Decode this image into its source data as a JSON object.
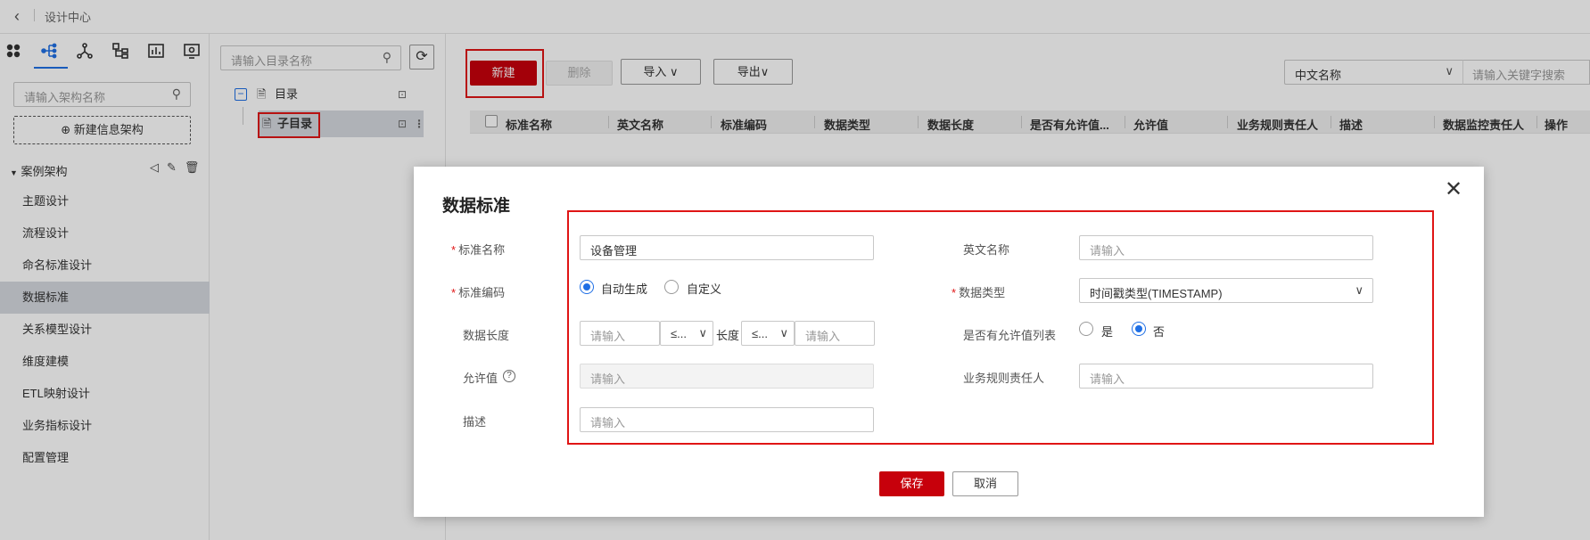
{
  "topbar": {
    "back_icon": "chevron-left-icon",
    "title": "设计中心"
  },
  "sidebar": {
    "search_placeholder": "请输入架构名称",
    "new_button": "⊕ 新建信息架构",
    "architecture": "案例架构",
    "items": [
      {
        "label": "主题设计"
      },
      {
        "label": "流程设计"
      },
      {
        "label": "命名标准设计"
      },
      {
        "label": "数据标准",
        "active": true
      },
      {
        "label": "关系模型设计"
      },
      {
        "label": "维度建模"
      },
      {
        "label": "ETL映射设计"
      },
      {
        "label": "业务指标设计"
      },
      {
        "label": "配置管理"
      }
    ]
  },
  "tree": {
    "search_placeholder": "请输入目录名称",
    "root": "目录",
    "child": "子目录"
  },
  "toolbar": {
    "new": "新建",
    "delete": "删除",
    "import": "导入 ∨",
    "export": "导出∨",
    "lang_select": "中文名称",
    "keyword_placeholder": "请输入关键字搜索"
  },
  "table": {
    "headers": [
      "标准名称",
      "英文名称",
      "标准编码",
      "数据类型",
      "数据长度",
      "是否有允许值...",
      "允许值",
      "业务规则责任人",
      "描述",
      "数据监控责任人",
      "操作"
    ]
  },
  "modal": {
    "title": "数据标准",
    "fields": {
      "std_name_label": "标准名称",
      "std_name_value": "设备管理",
      "en_name_label": "英文名称",
      "en_name_placeholder": "请输入",
      "std_code_label": "标准编码",
      "radio_auto": "自动生成",
      "radio_custom": "自定义",
      "data_type_label": "数据类型",
      "data_type_value": "时间戳类型(TIMESTAMP)",
      "data_length_label": "数据长度",
      "len_min_placeholder": "请输入",
      "op_1": "≤...",
      "length_word": "长度",
      "op_2": "≤...",
      "len_max_placeholder": "请输入",
      "has_allowed_label": "是否有允许值列表",
      "radio_yes": "是",
      "radio_no": "否",
      "allowed_label": "允许值",
      "allowed_placeholder": "请输入",
      "owner_label": "业务规则责任人",
      "owner_placeholder": "请输入",
      "desc_label": "描述",
      "desc_placeholder": "请输入"
    },
    "save": "保存",
    "cancel": "取消"
  },
  "colors": {
    "brand_red": "#c7000b",
    "highlight_red": "#e01515",
    "accent_blue": "#1f6fe5"
  }
}
